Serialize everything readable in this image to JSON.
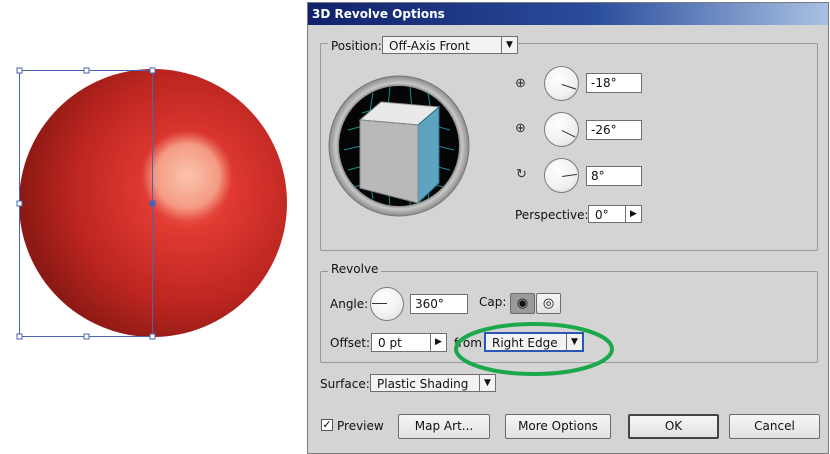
{
  "dialog": {
    "title": "3D Revolve Options"
  },
  "position": {
    "label": "Position:",
    "preset": "Off-Axis Front",
    "x_rotation": "-18°",
    "y_rotation": "-26°",
    "z_rotation": "8°",
    "perspective_label": "Perspective:",
    "perspective": "0°"
  },
  "revolve": {
    "title": "Revolve",
    "angle_label": "Angle:",
    "angle": "360°",
    "cap_label": "Cap:",
    "offset_label": "Offset:",
    "offset": "0 pt",
    "from_label": "from",
    "from": "Right Edge"
  },
  "surface": {
    "label": "Surface:",
    "value": "Plastic Shading"
  },
  "footer": {
    "preview_label": "Preview",
    "preview_checked": true,
    "map_art": "Map Art...",
    "more_options": "More Options",
    "ok": "OK",
    "cancel": "Cancel"
  },
  "colors": {
    "sphere": "#c62a25",
    "cube_front": "#5ca4bf",
    "highlight_ellipse": "#1aa84a",
    "selection": "#4a64b5",
    "title_bar": "#11216b"
  },
  "icons": {
    "x_axis": "rotate-x-icon",
    "y_axis": "rotate-y-icon",
    "z_axis": "rotate-z-icon",
    "cap_on": "cap-on-icon",
    "cap_off": "cap-off-icon"
  }
}
